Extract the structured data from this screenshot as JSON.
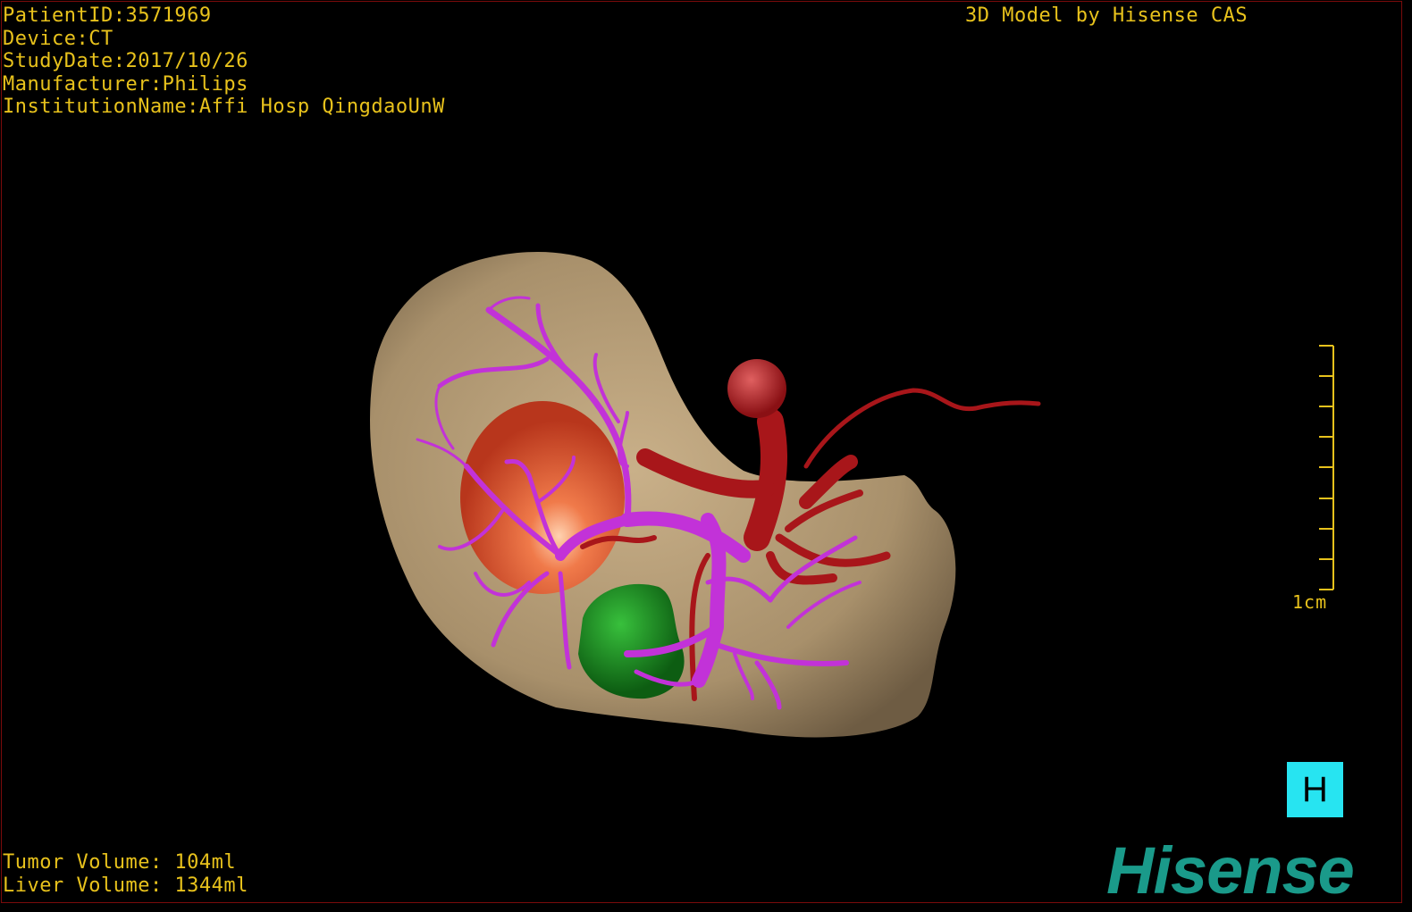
{
  "overlay": {
    "patient_id": "PatientID:3571969",
    "device": "Device:CT",
    "study_date": "StudyDate:2017/10/26",
    "manufacturer": "Manufacturer:Philips",
    "institution": "InstitutionName:Affi Hosp QingdaoUnW",
    "model_credit": "3D Model by Hisense CAS",
    "tumor_volume": "Tumor Volume: 104ml",
    "liver_volume": "Liver Volume: 1344ml"
  },
  "scale": {
    "label": "1cm"
  },
  "orientation": {
    "label": "H"
  },
  "brand": {
    "logo_text": "Hisense"
  },
  "colors": {
    "text": "#e8c21c",
    "liver": "#b9a07a",
    "tumor": "#e35a34",
    "portal_vein": "#c232d8",
    "artery": "#a8161a",
    "gallbladder": "#1e8e22",
    "orientation_bg": "#27e4f1",
    "brand": "#1a9a8a",
    "border": "#7a0b0b"
  }
}
